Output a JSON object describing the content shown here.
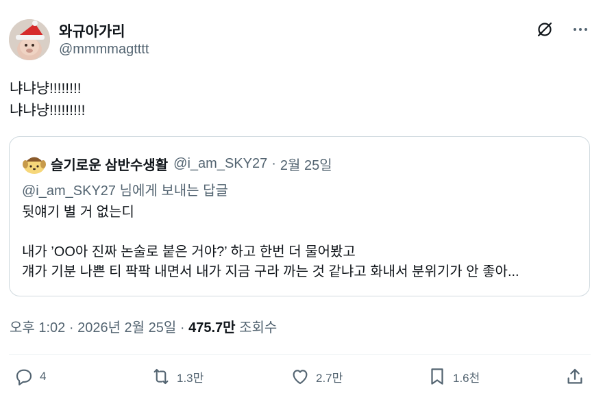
{
  "author": {
    "display_name": "와규아가리",
    "handle": "@mmmmagtttt"
  },
  "top_actions": {
    "grok_icon": "grok-icon",
    "more_icon": "more-icon"
  },
  "tweet": {
    "lines": [
      "냐냐냥!!!!!!!!",
      "냐냐냥!!!!!!!!!"
    ]
  },
  "quote": {
    "display_name": "슬기로운 삼반수생활",
    "handle": "@i_am_SKY27",
    "separator": "·",
    "date": "2월 25일",
    "reply_context": "@i_am_SKY27 님에게 보내는 답글",
    "lines": [
      "뒷얘기 별 거 없는디",
      "",
      "내가 ’OO아 진짜 논술로 붙은 거야?’ 하고 한번 더 물어봤고",
      "걔가 기분 나쁜 티 팍팍 내면서 내가 지금 구라 까는 것 같냐고 화내서 분위기가 안 좋아..."
    ]
  },
  "meta": {
    "time": "오후 1:02",
    "separator": "·",
    "date": "2026년 2월 25일",
    "views_count": "475.7만",
    "views_label": "조회수"
  },
  "actions": {
    "reply_count": "4",
    "retweet_count": "1.3만",
    "like_count": "2.7만",
    "bookmark_count": "1.6천"
  },
  "colors": {
    "text_primary": "#0f1419",
    "text_secondary": "#536471",
    "border": "#cfd9de"
  }
}
